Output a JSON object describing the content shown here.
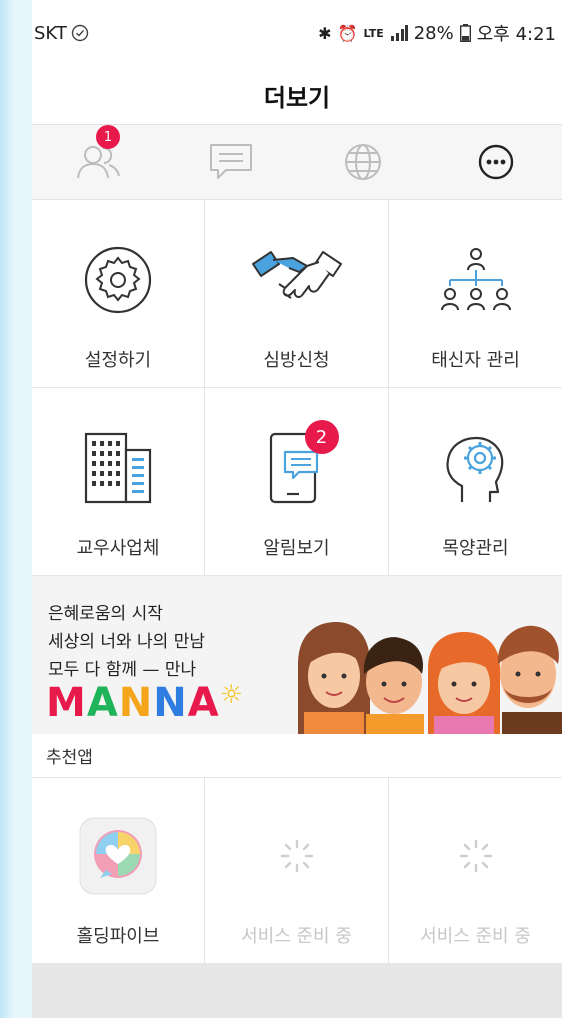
{
  "status": {
    "carrier": "SKT",
    "network": "LTE",
    "battery": "28%",
    "time": "오후 4:21"
  },
  "title": "더보기",
  "tabs": [
    {
      "name": "people",
      "badge": "1"
    },
    {
      "name": "chat"
    },
    {
      "name": "globe"
    },
    {
      "name": "more"
    }
  ],
  "menu": [
    {
      "label": "설정하기",
      "icon": "gear-icon"
    },
    {
      "label": "심방신청",
      "icon": "handshake-icon"
    },
    {
      "label": "태신자 관리",
      "icon": "org-chart-icon"
    },
    {
      "label": "교우사업체",
      "icon": "building-icon"
    },
    {
      "label": "알림보기",
      "icon": "tablet-message-icon",
      "badge": "2"
    },
    {
      "label": "목양관리",
      "icon": "head-gear-icon"
    }
  ],
  "banner": {
    "lines": [
      "은혜로움의 시작",
      "세상의 너와 나의 만남",
      "모두 다 함께 — 만나"
    ],
    "logo": "MANNA",
    "logo_colors": [
      "#e8194b",
      "#1fb35a",
      "#f4a51c",
      "#2f7de1",
      "#e8194b"
    ]
  },
  "section_title": "추천앱",
  "apps": [
    {
      "label": "홀딩파이브",
      "muted": false
    },
    {
      "label": "서비스 준비 중",
      "muted": true
    },
    {
      "label": "서비스 준비 중",
      "muted": true
    }
  ]
}
